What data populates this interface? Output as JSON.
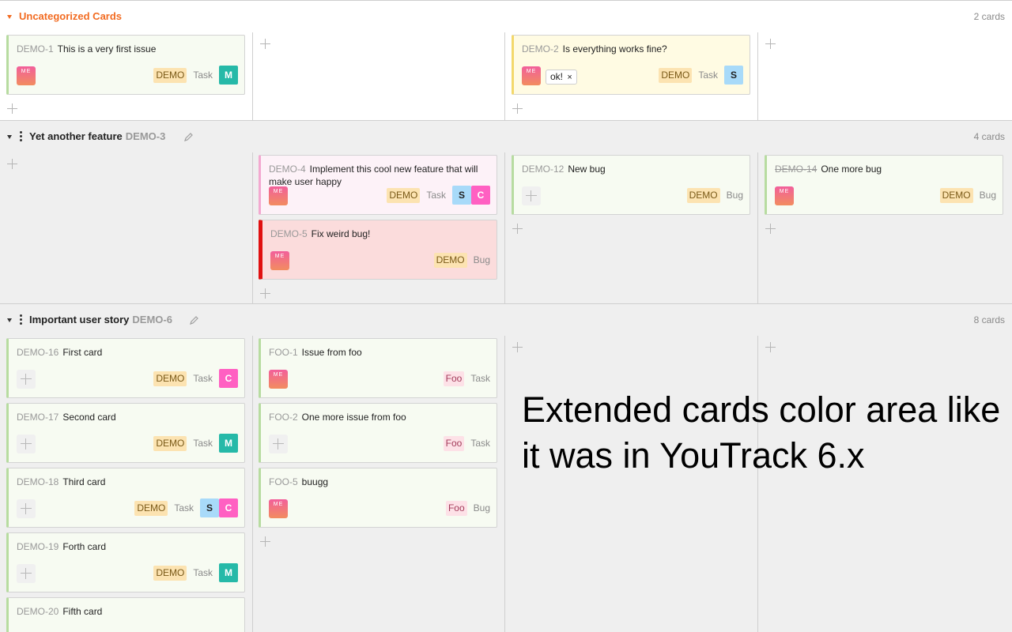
{
  "colors": {
    "accent_orange": "#f26b21",
    "card_normal_bg": "#f7fbf2",
    "card_normal_border": "#b7dca0",
    "card_yellow_bg": "#fffbe3",
    "card_yellow_border": "#f3d86b",
    "card_pink_bg": "#fdf2f8",
    "card_pink_border": "#f3a9d0",
    "card_red_bg": "#fbdcdc",
    "card_red_border": "#e01010",
    "assignee_m": "#26b9a8",
    "assignee_c": "#ff60c2",
    "assignee_s": "#a8daf9"
  },
  "swimlanes": [
    {
      "title": "Uncategorized Cards",
      "issue_id": "",
      "count": "2 cards",
      "cards": [
        {
          "id": "DEMO-1",
          "summary": "This is a very first issue",
          "project": "DEMO",
          "type": "Task",
          "assignees": [
            "M"
          ],
          "color": "normal",
          "resolved": false,
          "has_me_avatar": true
        },
        {
          "id": "DEMO-2",
          "summary": "Is everything works fine?",
          "project": "DEMO",
          "type": "Task",
          "assignees": [
            "S"
          ],
          "color": "yellow",
          "resolved": false,
          "has_me_avatar": true,
          "tag": "ok!"
        }
      ]
    },
    {
      "title": "Yet another feature",
      "issue_id": "DEMO-3",
      "count": "4 cards",
      "cards": [
        {
          "id": "DEMO-4",
          "summary": "Implement this cool new feature that will make user happy",
          "project": "DEMO",
          "type": "Task",
          "assignees": [
            "S",
            "C"
          ],
          "color": "pink",
          "resolved": false,
          "has_me_avatar": true
        },
        {
          "id": "DEMO-5",
          "summary": "Fix weird bug!",
          "project": "DEMO",
          "type": "Bug",
          "assignees": [],
          "color": "red",
          "resolved": false,
          "has_me_avatar": true
        },
        {
          "id": "DEMO-12",
          "summary": "New bug",
          "project": "DEMO",
          "type": "Bug",
          "assignees": [],
          "color": "normal",
          "resolved": false,
          "has_me_avatar": false
        },
        {
          "id": "DEMO-14",
          "summary": "One more bug",
          "project": "DEMO",
          "type": "Bug",
          "assignees": [],
          "color": "normal",
          "resolved": true,
          "has_me_avatar": true
        }
      ]
    },
    {
      "title": "Important user story",
      "issue_id": "DEMO-6",
      "count": "8 cards",
      "cards": [
        {
          "id": "DEMO-16",
          "summary": "First card",
          "project": "DEMO",
          "type": "Task",
          "assignees": [
            "C"
          ],
          "color": "normal",
          "resolved": false,
          "has_me_avatar": false
        },
        {
          "id": "DEMO-17",
          "summary": "Second card",
          "project": "DEMO",
          "type": "Task",
          "assignees": [
            "M"
          ],
          "color": "normal",
          "resolved": false,
          "has_me_avatar": false
        },
        {
          "id": "DEMO-18",
          "summary": "Third card",
          "project": "DEMO",
          "type": "Task",
          "assignees": [
            "S",
            "C"
          ],
          "color": "normal",
          "resolved": false,
          "has_me_avatar": false
        },
        {
          "id": "DEMO-19",
          "summary": "Forth card",
          "project": "DEMO",
          "type": "Task",
          "assignees": [
            "M"
          ],
          "color": "normal",
          "resolved": false,
          "has_me_avatar": false
        },
        {
          "id": "DEMO-20",
          "summary": "Fifth card",
          "project": "",
          "type": "",
          "assignees": [],
          "color": "normal",
          "resolved": false,
          "has_me_avatar": false
        },
        {
          "id": "FOO-1",
          "summary": "Issue from foo",
          "project": "Foo",
          "type": "Task",
          "assignees": [],
          "color": "normal",
          "resolved": false,
          "has_me_avatar": true
        },
        {
          "id": "FOO-2",
          "summary": "One more issue from foo",
          "project": "Foo",
          "type": "Task",
          "assignees": [],
          "color": "normal",
          "resolved": false,
          "has_me_avatar": false
        },
        {
          "id": "FOO-5",
          "summary": "buugg",
          "project": "Foo",
          "type": "Bug",
          "assignees": [],
          "color": "normal",
          "resolved": false,
          "has_me_avatar": true
        }
      ]
    }
  ],
  "avatar_me_label": "ME",
  "tag_remove_symbol": "×",
  "overlay_caption": "Extended cards color area like it was in YouTrack 6.x"
}
